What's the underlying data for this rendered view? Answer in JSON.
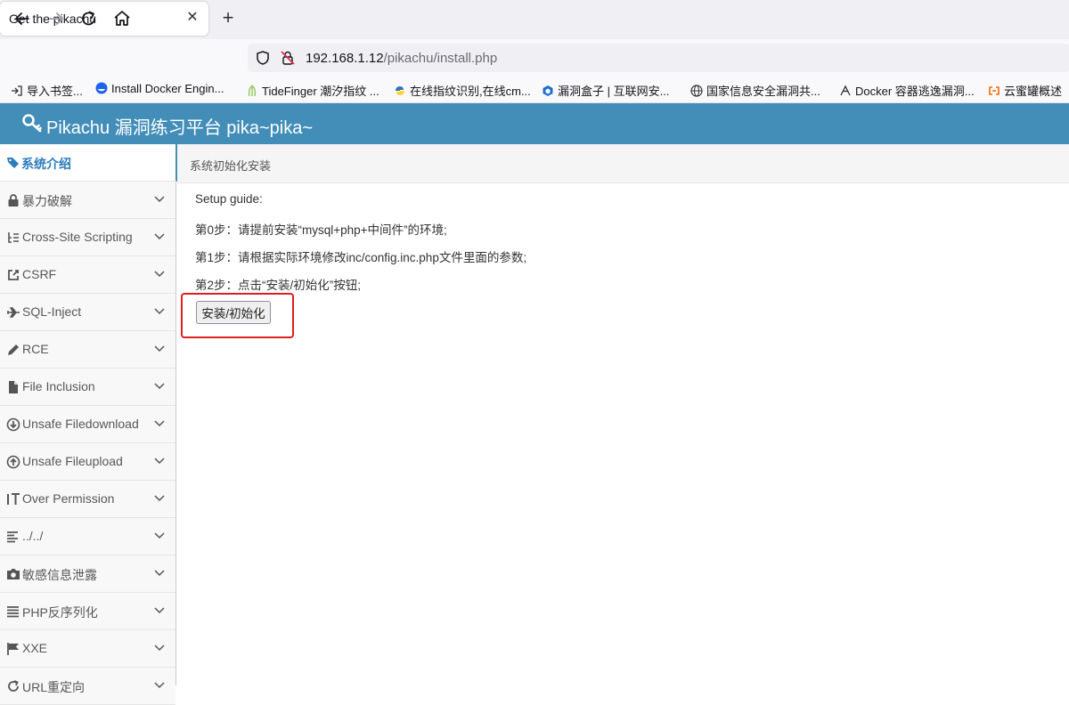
{
  "browser": {
    "tab_title": "Get the pikachu",
    "tab_close": "✕",
    "new_tab": "+",
    "url_host": "192.168.1.12",
    "url_path": "/pikachu/install.php",
    "bookmarks": [
      {
        "label": "导入书签...",
        "icon": "import-icon"
      },
      {
        "label": "Install Docker Engin...",
        "icon": "docker-site-icon"
      },
      {
        "label": "TideFinger 潮汐指纹 ...",
        "icon": "tidefinger-icon"
      },
      {
        "label": "在线指纹识别,在线cm...",
        "icon": "python-icon"
      },
      {
        "label": "漏洞盒子 | 互联网安...",
        "icon": "vulbox-icon"
      },
      {
        "label": "国家信息安全漏洞共...",
        "icon": "globe-icon"
      },
      {
        "label": "Docker 容器逃逸漏洞...",
        "icon": "escape-icon"
      },
      {
        "label": "云蜜罐概述",
        "icon": "aliyun-icon"
      }
    ]
  },
  "app": {
    "title": "Pikachu 漏洞练习平台 pika~pika~",
    "header_color": "#438eb9"
  },
  "sidebar": {
    "items": [
      {
        "label": "系统介绍",
        "icon": "tags-icon",
        "active": true
      },
      {
        "label": "暴力破解",
        "icon": "lock-icon"
      },
      {
        "label": "Cross-Site Scripting",
        "icon": "list-tree-icon"
      },
      {
        "label": "CSRF",
        "icon": "share-icon"
      },
      {
        "label": "SQL-Inject",
        "icon": "plane-icon"
      },
      {
        "label": "RCE",
        "icon": "pencil-icon"
      },
      {
        "label": "File Inclusion",
        "icon": "file-icon"
      },
      {
        "label": "Unsafe Filedownload",
        "icon": "download-circle-icon"
      },
      {
        "label": "Unsafe Fileupload",
        "icon": "upload-circle-icon"
      },
      {
        "label": "Over Permission",
        "icon": "text-size-icon"
      },
      {
        "label": "../../",
        "icon": "align-left-icon"
      },
      {
        "label": "敏感信息泄露",
        "icon": "camera-icon"
      },
      {
        "label": "PHP反序列化",
        "icon": "align-justify-icon"
      },
      {
        "label": "XXE",
        "icon": "flag-icon"
      },
      {
        "label": "URL重定向",
        "icon": "refresh-icon"
      }
    ]
  },
  "main": {
    "breadcrumb": "系统初始化安装",
    "guide_title": "Setup guide:",
    "step0": "第0步：请提前安装“mysql+php+中间件”的环境;",
    "step1": "第1步：请根据实际环境修改inc/config.inc.php文件里面的参数;",
    "step2": "第2步：点击“安装/初始化”按钮;",
    "install_button": "安装/初始化",
    "highlight_color": "#e0201f"
  }
}
